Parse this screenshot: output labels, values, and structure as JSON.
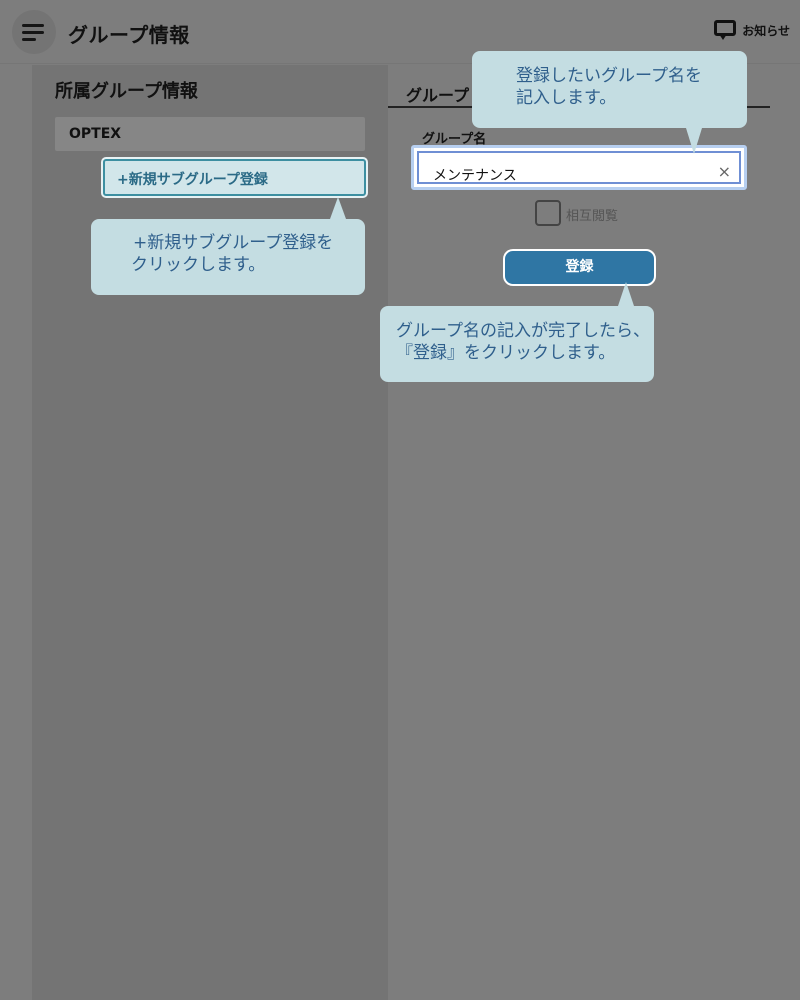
{
  "header": {
    "title": "グループ情報",
    "notice_label": "お知らせ",
    "menu_icon": "hamburger-menu-icon",
    "notice_icon": "chat-bubble-icon"
  },
  "left_panel": {
    "section_title": "所属グループ情報",
    "group_name": "OPTEX",
    "new_subgroup_button": "+新規サブグループ登録"
  },
  "right_panel": {
    "tab_label": "グループ",
    "field_label": "グループ名",
    "group_name_value": "メンテナンス",
    "clear_icon": "×",
    "checkbox_label": "相互閲覧",
    "checkbox_checked": false,
    "register_button": "登録"
  },
  "callouts": {
    "input_hint": {
      "line1": "登録したいグループ名を",
      "line2": "記入します。"
    },
    "new_subgroup_hint": {
      "line1": "+新規サブグループ登録を",
      "line2": "クリックします。"
    },
    "register_hint": {
      "line1": "グループ名の記入が完了したら、",
      "line2": "『登録』をクリックします。"
    }
  },
  "colors": {
    "callout_bg": "#c4dde2",
    "callout_text": "#2f5f8c",
    "register_button_bg": "#2f76a4",
    "new_subgroup_button_bg": "#d2e6ea"
  }
}
